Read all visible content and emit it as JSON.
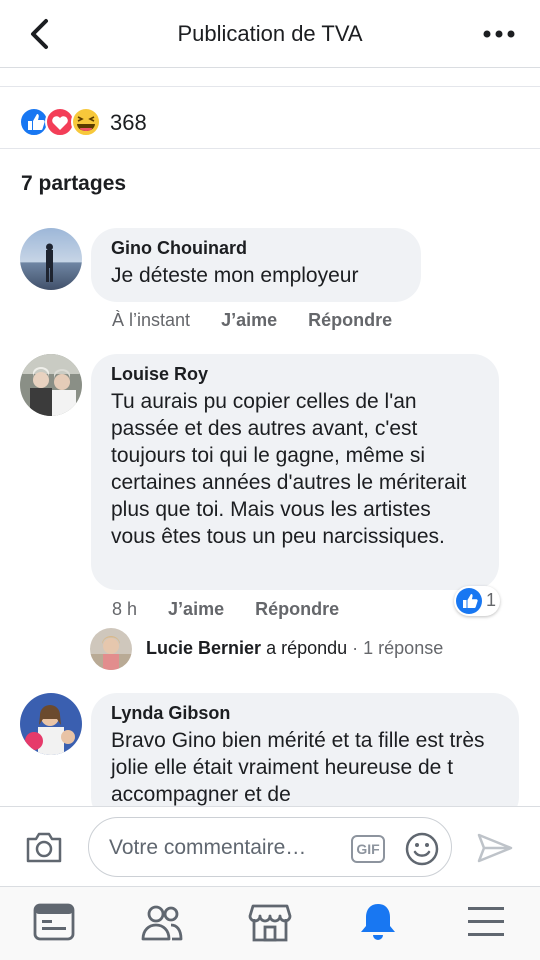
{
  "header": {
    "title": "Publication de TVA"
  },
  "reactions": {
    "count": "368",
    "types": [
      "like-icon",
      "love-icon",
      "haha-icon"
    ]
  },
  "shares": {
    "label": "7 partages"
  },
  "comments": [
    {
      "author": "Gino Chouinard",
      "text": "Je déteste mon employeur",
      "time": "À l’instant",
      "like_label": "J’aime",
      "reply_label": "Répondre"
    },
    {
      "author": "Louise Roy",
      "text": "Tu aurais pu copier celles de l'an passée et des autres avant, c'est toujours toi qui le gagne, même si certaines années d'autres le mériterait plus que toi. Mais vous les artistes vous êtes tous un peu narcissiques.",
      "time": "8 h",
      "like_label": "J’aime",
      "reply_label": "Répondre",
      "like_count": "1",
      "reply_summary": {
        "author": "Lucie Bernier",
        "action": "a répondu",
        "count": "· 1 réponse"
      }
    },
    {
      "author": "Lynda Gibson",
      "text": "Bravo Gino bien mérité et ta fille est très jolie elle était vraiment heureuse de t accompagner et de"
    }
  ],
  "composer": {
    "placeholder": "Votre commentaire…",
    "gif_label": "GIF"
  },
  "tabs": [
    "news-feed-icon",
    "friends-icon",
    "marketplace-icon",
    "notifications-icon",
    "menu-icon"
  ],
  "colors": {
    "accent": "#1877f2",
    "bubble": "#f0f2f5",
    "secondary_text": "#65676b"
  }
}
